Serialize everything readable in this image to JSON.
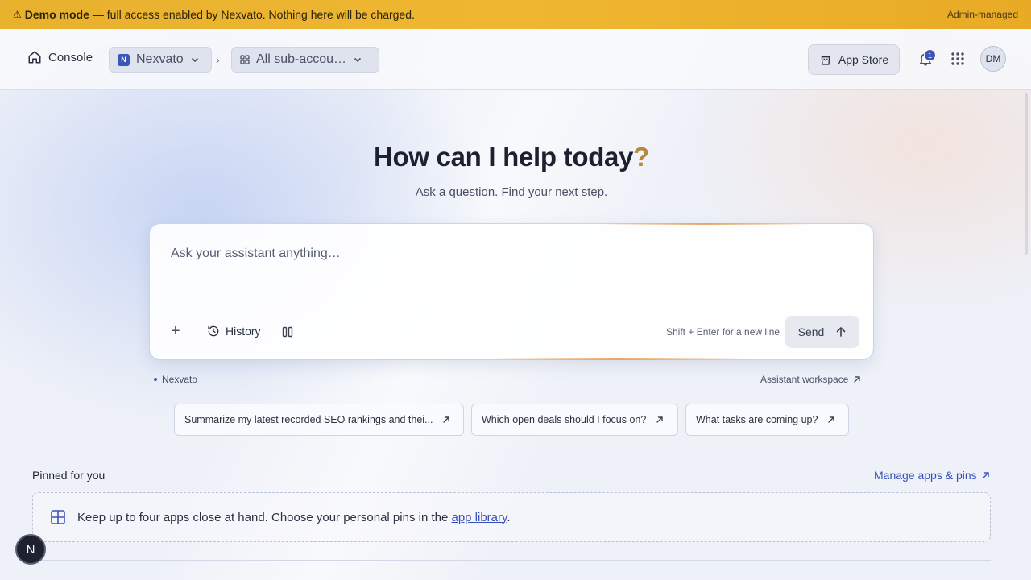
{
  "banner": {
    "icon": "warning-icon",
    "title": "Demo mode",
    "message": "— full access enabled by Nexvato. Nothing here will be charged.",
    "right_label": "Admin-managed"
  },
  "header": {
    "console_label": "Console",
    "org_badge": "N",
    "org_name": "Nexvato",
    "breadcrumb_separator": "›",
    "subaccount_label": "All sub-accou…",
    "app_store_label": "App Store",
    "notification_count": "1",
    "avatar_initials": "DM"
  },
  "hero": {
    "title": "How can I help today",
    "title_mark": "?",
    "subtitle": "Ask a question. Find your next step."
  },
  "composer": {
    "placeholder": "Ask your assistant anything…",
    "plus_label": "+",
    "history_label": "History",
    "hint": "Shift + Enter for a new line",
    "send_label": "Send"
  },
  "context": {
    "org_tag": "Nexvato",
    "workspace_link": "Assistant workspace"
  },
  "suggestions": [
    "Summarize my latest recorded SEO rankings and thei...",
    "Which open deals should I focus on?",
    "What tasks are coming up?"
  ],
  "pinned": {
    "label": "Pinned for you",
    "manage_link": "Manage apps & pins",
    "empty_text": "Keep up to four apps close at hand. Choose your personal pins in the",
    "empty_link": "app library",
    "empty_end": "."
  },
  "fab_label": "N",
  "colors": {
    "banner": "#efb731",
    "accent": "#3c55b8",
    "link": "#3450b8",
    "title_mark": "#b68a3a"
  }
}
